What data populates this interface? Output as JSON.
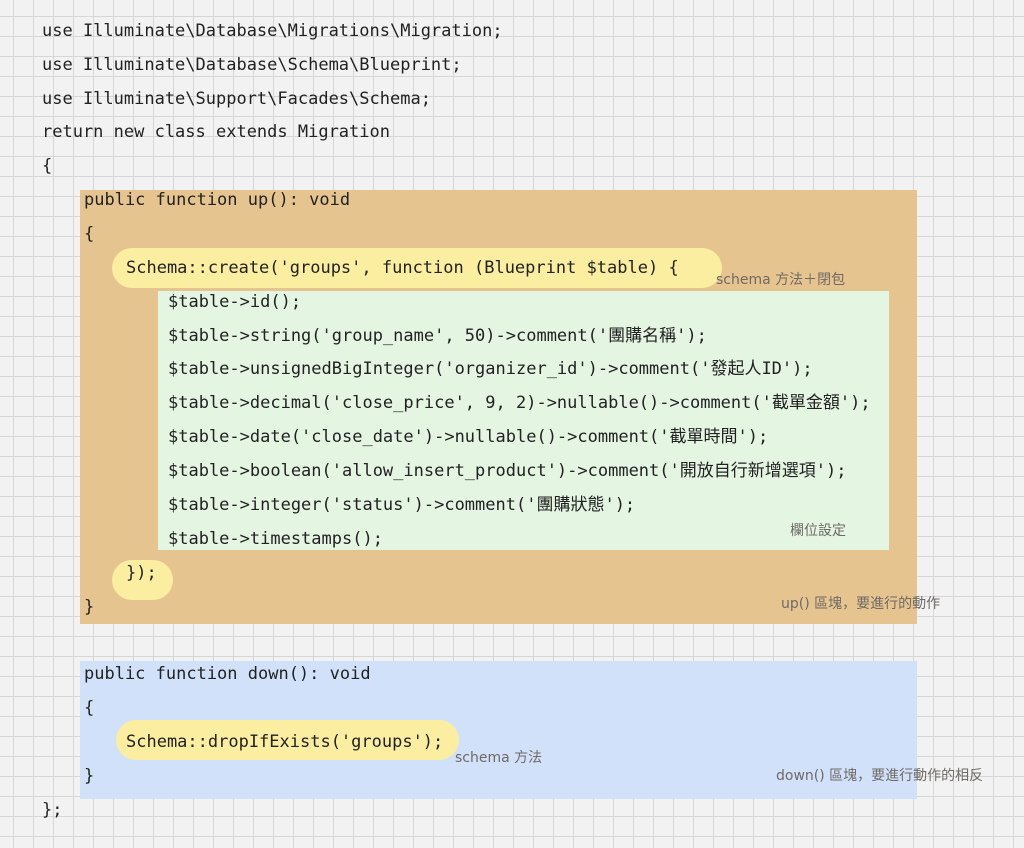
{
  "header_lines": [
    "use Illuminate\\Database\\Migrations\\Migration;",
    "use Illuminate\\Database\\Schema\\Blueprint;",
    "use Illuminate\\Support\\Facades\\Schema;",
    "return new class extends Migration",
    "{"
  ],
  "up": {
    "signature": "public function up(): void",
    "open_brace": "{",
    "create_call": "Schema::create('groups', function (Blueprint $table) {",
    "fields": [
      "$table->id();",
      "$table->string('group_name', 50)->comment('團購名稱');",
      "$table->unsignedBigInteger('organizer_id')->comment('發起人ID');",
      "$table->decimal('close_price', 9, 2)->nullable()->comment('截單金額');",
      "$table->date('close_date')->nullable()->comment('截單時間');",
      "$table->boolean('allow_insert_product')->comment('開放自行新增選項');",
      "$table->integer('status')->comment('團購狀態');",
      "$table->timestamps();"
    ],
    "closure_end": "});",
    "close_brace": "}"
  },
  "down": {
    "signature": "public function down(): void",
    "open_brace": "{",
    "drop_call": "Schema::dropIfExists('groups');",
    "close_brace": "}"
  },
  "footer_line": "};",
  "notes": {
    "schema_closure": "schema 方法＋閉包",
    "fields": "欄位設定",
    "up_block": "up() 區塊，要進行的動作",
    "schema_method": "schema 方法",
    "down_block": "down() 區塊，要進行動作的相反"
  },
  "colors": {
    "up_block": "#e6c48f",
    "fields_block": "#e4f5e2",
    "down_block": "#d2e1fa",
    "highlight": "#fbeea0"
  }
}
